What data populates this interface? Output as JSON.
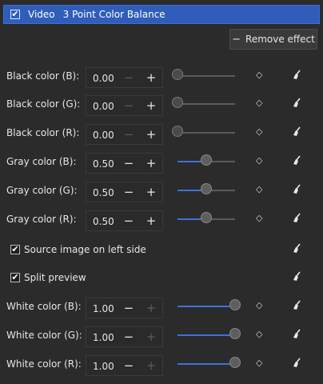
{
  "header": {
    "checked": true,
    "checkmark": "✔",
    "category": "Video",
    "title": "3 Point Color Balance"
  },
  "actions": {
    "remove_icon": "−",
    "remove_label": "Remove effect"
  },
  "icons": {
    "keyframe": "diamond-icon",
    "reset": "broom-icon",
    "minus": "−",
    "plus": "+",
    "check": "✔"
  },
  "params": [
    {
      "label": "Black color (B):",
      "value": "0.00",
      "slider": 0.0,
      "minus_enabled": false,
      "plus_enabled": true
    },
    {
      "label": "Black color (G):",
      "value": "0.00",
      "slider": 0.0,
      "minus_enabled": false,
      "plus_enabled": true
    },
    {
      "label": "Black color (R):",
      "value": "0.00",
      "slider": 0.0,
      "minus_enabled": false,
      "plus_enabled": true
    },
    {
      "label": "Gray color (B):",
      "value": "0.50",
      "slider": 0.5,
      "minus_enabled": true,
      "plus_enabled": true
    },
    {
      "label": "Gray color (G):",
      "value": "0.50",
      "slider": 0.5,
      "minus_enabled": true,
      "plus_enabled": true
    },
    {
      "label": "Gray color (R):",
      "value": "0.50",
      "slider": 0.5,
      "minus_enabled": true,
      "plus_enabled": true
    }
  ],
  "options": [
    {
      "label": "Source image on left side",
      "checked": true
    },
    {
      "label": "Split preview",
      "checked": true
    }
  ],
  "params2": [
    {
      "label": "White color (B):",
      "value": "1.00",
      "slider": 1.0,
      "minus_enabled": true,
      "plus_enabled": false
    },
    {
      "label": "White color (G):",
      "value": "1.00",
      "slider": 1.0,
      "minus_enabled": true,
      "plus_enabled": false
    },
    {
      "label": "White color (R):",
      "value": "1.00",
      "slider": 1.0,
      "minus_enabled": true,
      "plus_enabled": false
    }
  ],
  "colors": {
    "accent": "#3b73d8",
    "header": "#2f5db9",
    "background": "#2b2b2b"
  }
}
